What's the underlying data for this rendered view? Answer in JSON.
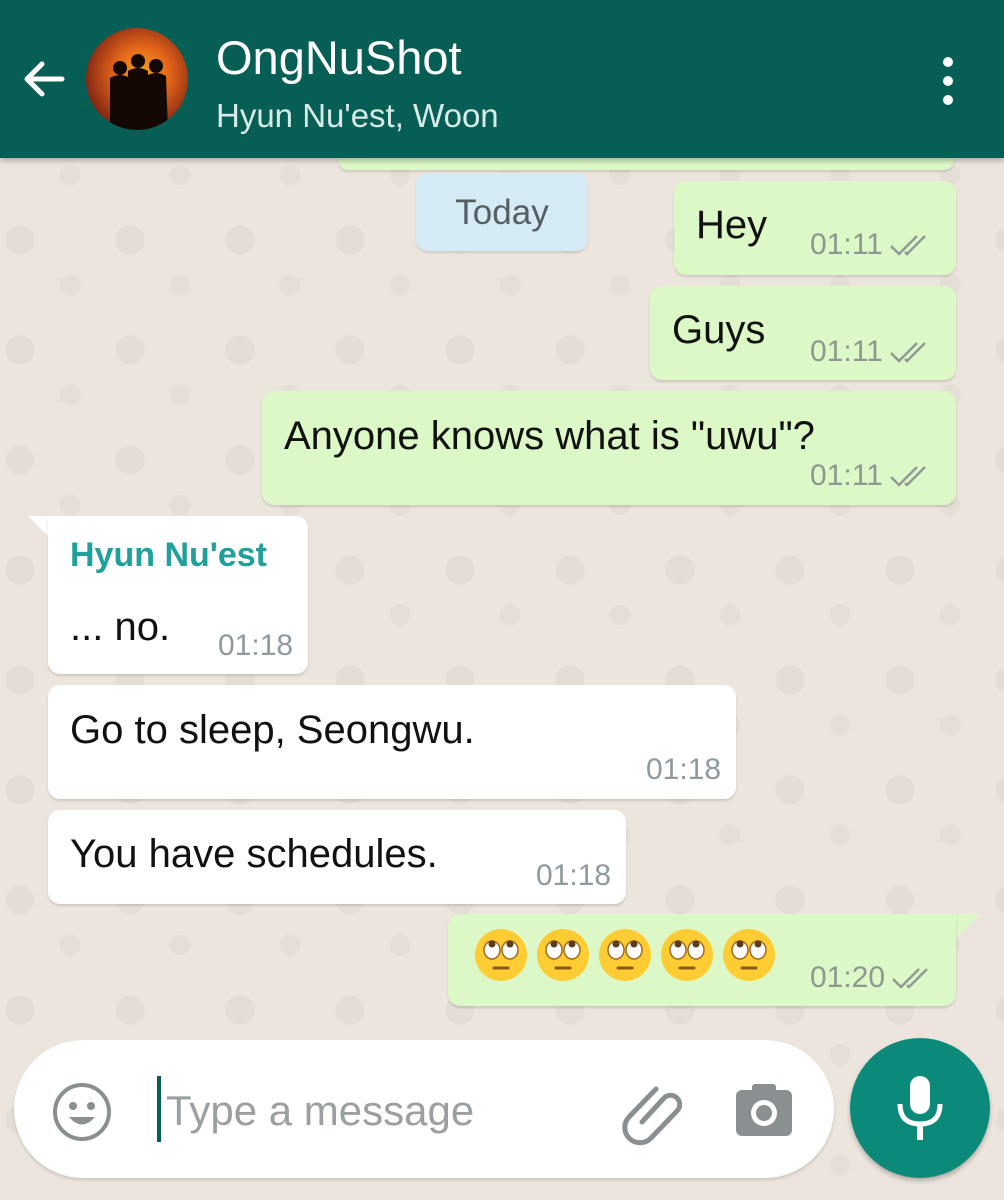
{
  "header": {
    "title": "OngNuShot",
    "members": "Hyun Nu'est, Woon",
    "back_icon": "arrow-back-icon",
    "menu_icon": "more-vert-icon"
  },
  "date_chip": "Today",
  "messages": [
    {
      "direction": "out",
      "text": "Hey",
      "time": "01:11",
      "status": "read-ticks"
    },
    {
      "direction": "out",
      "text": "Guys",
      "time": "01:11",
      "status": "read-ticks"
    },
    {
      "direction": "out",
      "text": "Anyone knows what is \"uwu\"?",
      "time": "01:11",
      "status": "read-ticks"
    },
    {
      "direction": "in",
      "sender": "Hyun Nu'est",
      "text": "... no.",
      "time": "01:18"
    },
    {
      "direction": "in",
      "text": "Go to sleep, Seongwu.",
      "time": "01:18"
    },
    {
      "direction": "in",
      "text": "You have schedules.",
      "time": "01:18"
    },
    {
      "direction": "out",
      "text": "🙄🙄🙄🙄🙄",
      "emoji_name": "face-with-rolling-eyes",
      "emoji_count": 5,
      "time": "01:20",
      "status": "read-ticks"
    }
  ],
  "input": {
    "placeholder": "Type a message",
    "emoji_icon": "smiley-icon",
    "attach_icon": "paperclip-icon",
    "camera_icon": "camera-icon",
    "mic_icon": "microphone-icon"
  },
  "colors": {
    "header": "#075e54",
    "outgoing_bubble": "#dcf8c6",
    "incoming_bubble": "#ffffff",
    "date_chip": "#d4eaf4",
    "sender_name": "#1fa09a",
    "mic_button": "#0b8a7a",
    "background": "#ece5dd"
  }
}
